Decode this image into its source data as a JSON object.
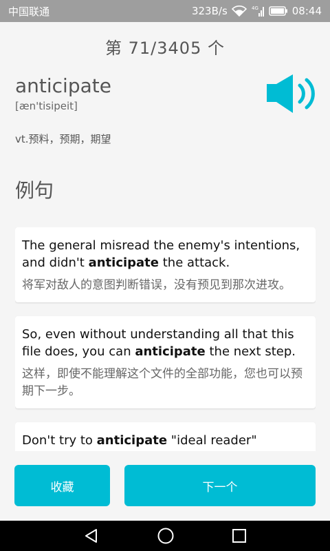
{
  "status": {
    "carrier": "中国联通",
    "speed": "323B/s",
    "network": "4G",
    "time": "08:44"
  },
  "counter": "第 71/3405 个",
  "word": {
    "text": "anticipate",
    "phonetic": "[æn'tisipeit]",
    "meaning": "vt.预料，预期，期望"
  },
  "section_title": "例句",
  "examples": [
    {
      "en_before": "The general misread the enemy's intentions, and didn't ",
      "keyword": "anticipate",
      "en_after": " the attack.",
      "zh": "将军对敌人的意图判断错误，没有预见到那次进攻。"
    },
    {
      "en_before": "So, even without understanding all that this file does, you can ",
      "keyword": "anticipate",
      "en_after": " the next step.",
      "zh": "这样，即使不能理解这个文件的全部功能，您也可以预期下一步。"
    },
    {
      "en_before": "Don't try to ",
      "keyword": "anticipate",
      "en_after": " \"ideal reader\"",
      "zh": ""
    }
  ],
  "buttons": {
    "favorite": "收藏",
    "next": "下一个"
  },
  "colors": {
    "accent": "#00bcd4",
    "status_bar": "#9e9e9e"
  }
}
